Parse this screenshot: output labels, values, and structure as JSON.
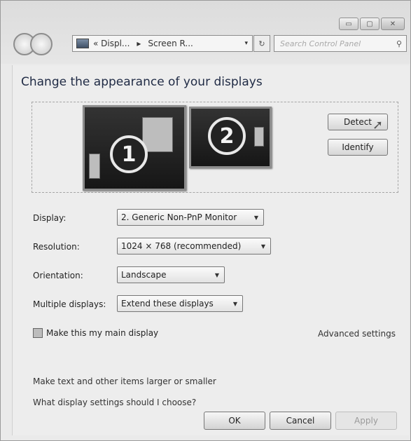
{
  "window": {
    "caption_minimize": "▭",
    "caption_maximize": "▢",
    "caption_close": "✕"
  },
  "navbar": {
    "breadcrumb_1": "« Displ...",
    "breadcrumb_sep": "▸",
    "breadcrumb_2": "Screen R...",
    "dropdown": "▾",
    "refresh": "↻",
    "search_placeholder": "Search Control Panel",
    "search_icon": "⚲"
  },
  "main": {
    "title": "Change the appearance of your displays",
    "monitor_1_number": "1",
    "monitor_2_number": "2",
    "detect_label": "Detect",
    "identify_label": "Identify"
  },
  "settings": {
    "display_label": "Display:",
    "display_value": "2. Generic Non-PnP Monitor",
    "resolution_label": "Resolution:",
    "resolution_value": "1024 × 768 (recommended)",
    "orientation_label": "Orientation:",
    "orientation_value": "Landscape",
    "multiple_label": "Multiple displays:",
    "multiple_value": "Extend these displays",
    "dropdown_arrow": "▼"
  },
  "options": {
    "main_display_label": "Make this my main display",
    "main_display_checked": false,
    "advanced_settings": "Advanced settings",
    "text_size_link": "Make text and other items larger or smaller",
    "help_link": "What display settings should I choose?"
  },
  "footer": {
    "ok": "OK",
    "cancel": "Cancel",
    "apply": "Apply"
  }
}
